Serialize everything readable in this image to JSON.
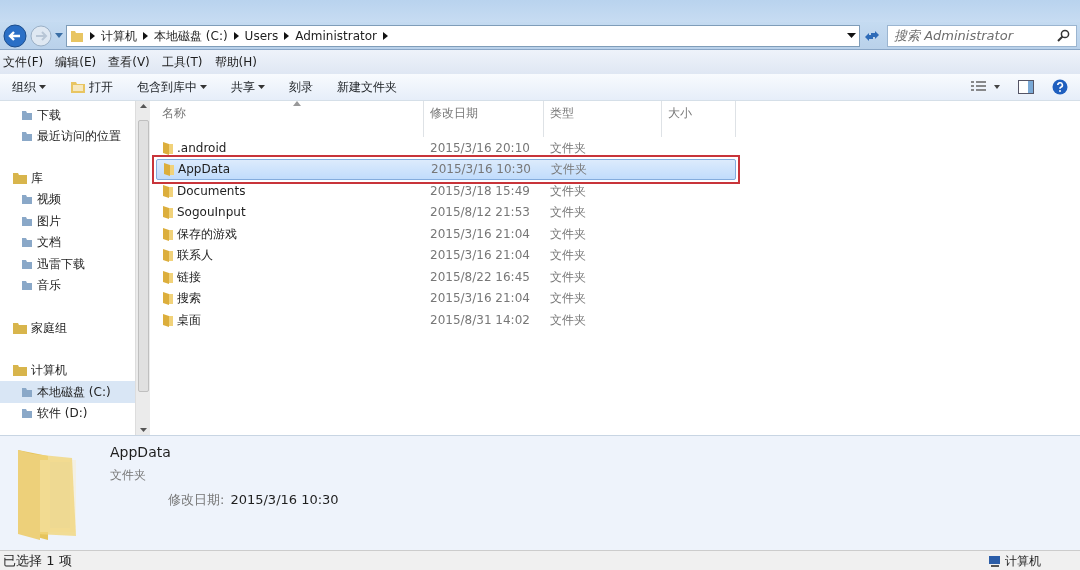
{
  "address_bar": {
    "breadcrumbs": [
      "计算机",
      "本地磁盘 (C:)",
      "Users",
      "Administrator"
    ]
  },
  "search": {
    "placeholder": "搜索 Administrator"
  },
  "menu_bar": [
    "文件(F)",
    "编辑(E)",
    "查看(V)",
    "工具(T)",
    "帮助(H)"
  ],
  "toolbar": [
    {
      "label": "组织",
      "dropdown": true,
      "icon": false
    },
    {
      "label": "打开",
      "dropdown": false,
      "icon": true
    },
    {
      "label": "包含到库中",
      "dropdown": true,
      "icon": false
    },
    {
      "label": "共享",
      "dropdown": true,
      "icon": false
    },
    {
      "label": "刻录",
      "dropdown": false,
      "icon": false
    },
    {
      "label": "新建文件夹",
      "dropdown": false,
      "icon": false
    }
  ],
  "sidebar": {
    "items": [
      {
        "kind": "item",
        "label": "下载",
        "selected": false
      },
      {
        "kind": "item",
        "label": "最近访问的位置",
        "selected": false
      },
      {
        "kind": "header",
        "label": "库",
        "selected": false
      },
      {
        "kind": "item",
        "label": "视频",
        "selected": false
      },
      {
        "kind": "item",
        "label": "图片",
        "selected": false
      },
      {
        "kind": "item",
        "label": "文档",
        "selected": false
      },
      {
        "kind": "item",
        "label": "迅雷下载",
        "selected": false
      },
      {
        "kind": "item",
        "label": "音乐",
        "selected": false
      },
      {
        "kind": "header",
        "label": "家庭组",
        "selected": false
      },
      {
        "kind": "header",
        "label": "计算机",
        "selected": false
      },
      {
        "kind": "item",
        "label": "本地磁盘 (C:)",
        "selected": true
      },
      {
        "kind": "item",
        "label": "软件 (D:)",
        "selected": false
      }
    ]
  },
  "table": {
    "columns": [
      "名称",
      "修改日期",
      "类型",
      "大小"
    ],
    "rows": [
      {
        "name": ".android",
        "modified": "2015/3/16 20:10",
        "type": "文件夹",
        "selected": false,
        "outlined": false
      },
      {
        "name": "AppData",
        "modified": "2015/3/16 10:30",
        "type": "文件夹",
        "selected": true,
        "outlined": true
      },
      {
        "name": "Documents",
        "modified": "2015/3/18 15:49",
        "type": "文件夹",
        "selected": false,
        "outlined": false
      },
      {
        "name": "SogouInput",
        "modified": "2015/8/12 21:53",
        "type": "文件夹",
        "selected": false,
        "outlined": false
      },
      {
        "name": "保存的游戏",
        "modified": "2015/3/16 21:04",
        "type": "文件夹",
        "selected": false,
        "outlined": false
      },
      {
        "name": "联系人",
        "modified": "2015/3/16 21:04",
        "type": "文件夹",
        "selected": false,
        "outlined": false
      },
      {
        "name": "链接",
        "modified": "2015/8/22 16:45",
        "type": "文件夹",
        "selected": false,
        "outlined": false
      },
      {
        "name": "搜索",
        "modified": "2015/3/16 21:04",
        "type": "文件夹",
        "selected": false,
        "outlined": false
      },
      {
        "name": "桌面",
        "modified": "2015/8/31 14:02",
        "type": "文件夹",
        "selected": false,
        "outlined": false
      }
    ]
  },
  "details": {
    "name": "AppData",
    "type": "文件夹",
    "modified_label": "修改日期:",
    "modified_value": "2015/3/16 10:30"
  },
  "status_bar": {
    "selection": "已选择 1 项",
    "location": "计算机"
  }
}
